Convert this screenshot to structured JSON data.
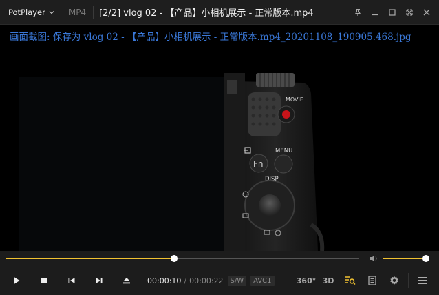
{
  "titlebar": {
    "app_name": "PotPlayer",
    "format": "MP4",
    "title": "[2/2] vlog 02 - 【产品】小相机展示 - 正常版本.mp4"
  },
  "osd": {
    "message": "画面截图: 保存为 vlog 02 - 【产品】小相机展示 - 正常版本.mp4_20201108_190905.468.jpg"
  },
  "camera": {
    "movie_label": "MOVIE",
    "menu_label": "MENU",
    "fn_label": "Fn",
    "disp_label": "DISP"
  },
  "playback": {
    "current_time": "00:00:10",
    "duration": "00:00:22",
    "progress_fraction": 0.476,
    "volume_fraction": 0.98,
    "sw_label": "S/W",
    "codec_label": "AVC1"
  },
  "right_controls": {
    "label_360": "360°",
    "label_3d": "3D"
  },
  "colors": {
    "accent": "#f1c231",
    "osd_text": "#3a78d8",
    "bar_bg": "#1c1c1c"
  }
}
